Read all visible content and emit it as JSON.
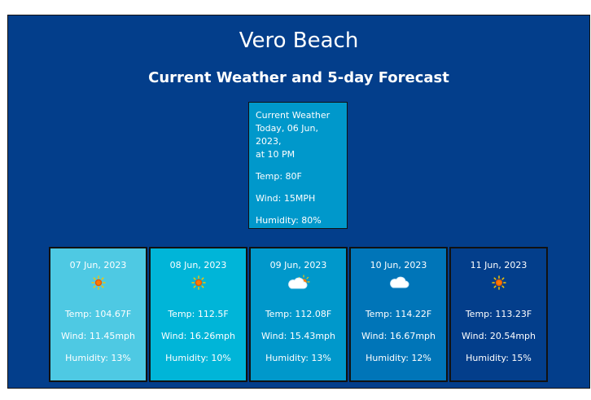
{
  "header": {
    "city": "Vero Beach",
    "subtitle": "Current Weather and 5-day Forecast"
  },
  "current": {
    "heading": "Current Weather",
    "datetime_line1": "Today, 06 Jun, 2023,",
    "datetime_line2": "at 10 PM",
    "temp": "Temp: 80F",
    "wind": "Wind: 15MPH",
    "humidity": "Humidity: 80%"
  },
  "forecast": [
    {
      "date": "07 Jun, 2023",
      "icon": "sun-icon",
      "temp": "Temp: 104.67F",
      "wind": "Wind: 11.45mph",
      "humidity": "Humidity: 13%",
      "color": "#4ec9e3"
    },
    {
      "date": "08 Jun, 2023",
      "icon": "sun-icon",
      "temp": "Temp: 112.5F",
      "wind": "Wind: 16.26mph",
      "humidity": "Humidity: 10%",
      "color": "#00b5d8"
    },
    {
      "date": "09 Jun, 2023",
      "icon": "partly-cloudy-icon",
      "temp": "Temp: 112.08F",
      "wind": "Wind: 15.43mph",
      "humidity": "Humidity: 13%",
      "color": "#0098cb"
    },
    {
      "date": "10 Jun, 2023",
      "icon": "cloud-icon",
      "temp": "Temp: 114.22F",
      "wind": "Wind: 16.67mph",
      "humidity": "Humidity: 12%",
      "color": "#0075b8"
    },
    {
      "date": "11 Jun, 2023",
      "icon": "sun-icon",
      "temp": "Temp: 113.23F",
      "wind": "Wind: 20.54mph",
      "humidity": "Humidity: 15%",
      "color": "#033e8b"
    }
  ],
  "colors": {
    "background": "#033e8b",
    "current_card": "#0098cb",
    "text": "#ffffff"
  }
}
